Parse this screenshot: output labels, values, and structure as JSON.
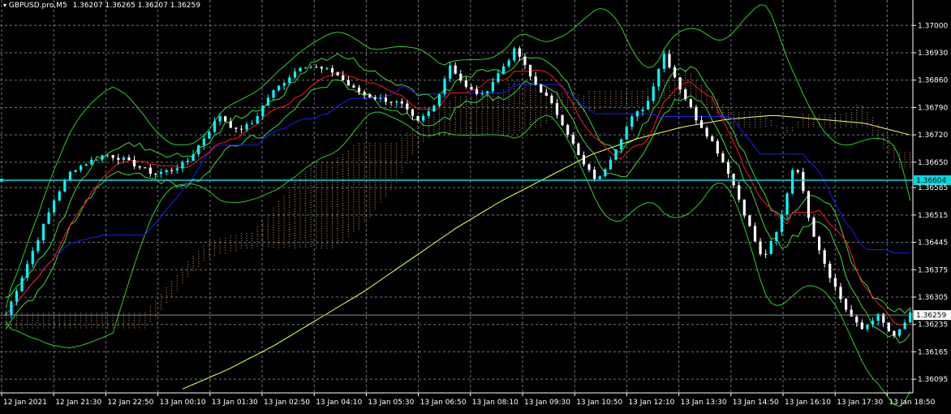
{
  "header": {
    "symbol_label": "GBPUSD.pro,M5",
    "ohlc_label": "1.36207 1.36265 1.36207 1.36259"
  },
  "horizontal_lines": {
    "cyan_level": "1.36604",
    "current_price": "1.36259"
  },
  "colors": {
    "background": "#000000",
    "grid": "#6b7a7a",
    "axis_text": "#ffffff",
    "bull_candle": "#00ffff",
    "bear_candle": "#ffffff",
    "cyan_line": "#00d8e0",
    "bollinger": "#2ecc2e",
    "envelope": "#3fd63f",
    "tenkan": "#ff1a1a",
    "kijun": "#1a1aff",
    "sma": "#ffff66",
    "kumo": "#f0a070"
  },
  "chart_data": {
    "type": "candlestick",
    "symbol": "GBPUSD.pro",
    "timeframe": "M5",
    "y_ticks": [
      "1.37000",
      "1.36930",
      "1.36860",
      "1.36790",
      "1.36720",
      "1.36650",
      "1.36585",
      "1.36515",
      "1.36445",
      "1.36375",
      "1.36305",
      "1.36235",
      "1.36165",
      "1.36095"
    ],
    "y_range": [
      1.3606,
      1.3704
    ],
    "x_ticks": [
      "12 Jan 2021",
      "12 Jan 21:30",
      "12 Jan 22:50",
      "13 Jan 00:10",
      "13 Jan 01:30",
      "13 Jan 02:50",
      "13 Jan 04:10",
      "13 Jan 05:30",
      "13 Jan 06:50",
      "13 Jan 08:10",
      "13 Jan 09:30",
      "13 Jan 10:50",
      "13 Jan 12:10",
      "13 Jan 13:30",
      "13 Jan 14:50",
      "13 Jan 16:10",
      "13 Jan 17:30",
      "13 Jan 18:50"
    ],
    "close_path": [
      1.3626,
      1.3636,
      1.3646,
      1.3656,
      1.3663,
      1.3665,
      1.3667,
      1.3666,
      1.3664,
      1.3662,
      1.3663,
      1.3665,
      1.3671,
      1.3677,
      1.3673,
      1.3675,
      1.3682,
      1.3686,
      1.369,
      1.3689,
      1.3688,
      1.3684,
      1.3682,
      1.3681,
      1.368,
      1.3675,
      1.3679,
      1.369,
      1.3684,
      1.3682,
      1.3688,
      1.3694,
      1.3686,
      1.3681,
      1.3674,
      1.3665,
      1.366,
      1.3668,
      1.3676,
      1.368,
      1.3693,
      1.3684,
      1.3676,
      1.367,
      1.3662,
      1.3651,
      1.364,
      1.3648,
      1.3666,
      1.3648,
      1.3637,
      1.3628,
      1.3622,
      1.3626,
      1.362,
      1.3626
    ],
    "indicators": {
      "sma_long": [
        1.3607,
        1.3612,
        1.3618,
        1.3625,
        1.3632,
        1.364,
        1.3648,
        1.3655,
        1.3661,
        1.3667,
        1.3671,
        1.3674,
        1.3676,
        1.3677,
        1.3676,
        1.3675,
        1.3672
      ],
      "cyan_horizontal": 1.36604,
      "current_price": 1.36259
    }
  }
}
